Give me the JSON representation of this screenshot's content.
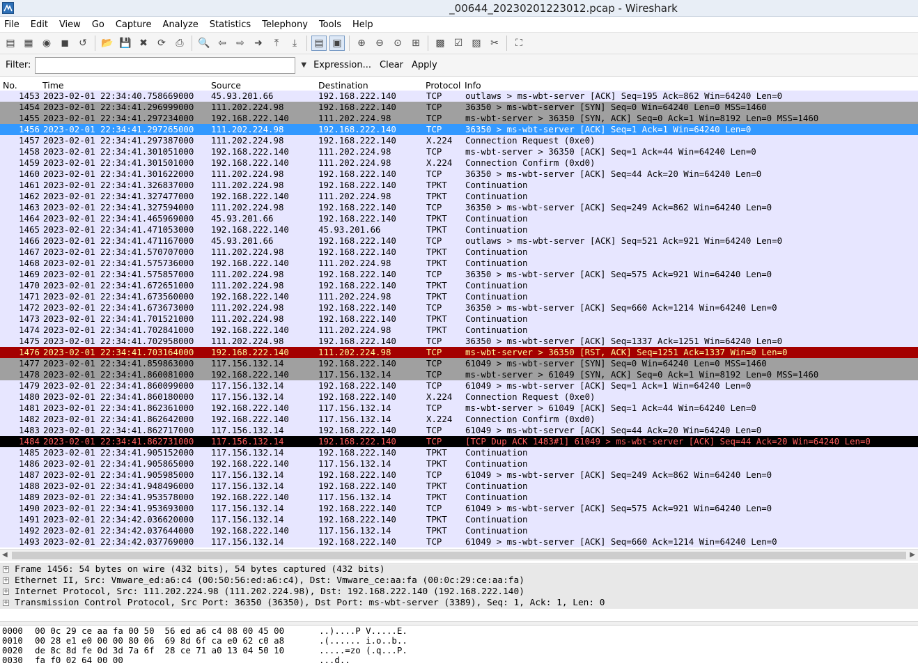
{
  "window": {
    "title": "_00644_20230201223012.pcap - Wireshark"
  },
  "menu": [
    "File",
    "Edit",
    "View",
    "Go",
    "Capture",
    "Analyze",
    "Statistics",
    "Telephony",
    "Tools",
    "Help"
  ],
  "toolbar": [
    {
      "name": "interfaces-icon",
      "glyph": "▤"
    },
    {
      "name": "capture-options-icon",
      "glyph": "▦"
    },
    {
      "name": "start-capture-icon",
      "glyph": "◉"
    },
    {
      "name": "stop-capture-icon",
      "glyph": "◼"
    },
    {
      "name": "restart-capture-icon",
      "glyph": "↺"
    },
    {
      "sep": true
    },
    {
      "name": "open-file-icon",
      "glyph": "📂"
    },
    {
      "name": "save-file-icon",
      "glyph": "💾"
    },
    {
      "name": "close-file-icon",
      "glyph": "✖"
    },
    {
      "name": "reload-icon",
      "glyph": "⟳"
    },
    {
      "name": "print-icon",
      "glyph": "⎙"
    },
    {
      "sep": true
    },
    {
      "name": "find-packet-icon",
      "glyph": "🔍"
    },
    {
      "name": "go-back-icon",
      "glyph": "⇦"
    },
    {
      "name": "go-forward-icon",
      "glyph": "⇨"
    },
    {
      "name": "go-to-packet-icon",
      "glyph": "➜"
    },
    {
      "name": "go-first-icon",
      "glyph": "⤒"
    },
    {
      "name": "go-last-icon",
      "glyph": "⤓"
    },
    {
      "sep": true
    },
    {
      "name": "colorize-icon",
      "glyph": "▤",
      "pressed": true
    },
    {
      "name": "auto-scroll-icon",
      "glyph": "▣",
      "pressed": true
    },
    {
      "sep": true
    },
    {
      "name": "zoom-in-icon",
      "glyph": "⊕"
    },
    {
      "name": "zoom-out-icon",
      "glyph": "⊖"
    },
    {
      "name": "zoom-normal-icon",
      "glyph": "⊙"
    },
    {
      "name": "resize-columns-icon",
      "glyph": "⊞"
    },
    {
      "sep": true
    },
    {
      "name": "capture-filters-icon",
      "glyph": "▩"
    },
    {
      "name": "display-filters-icon",
      "glyph": "☑"
    },
    {
      "name": "coloring-rules-icon",
      "glyph": "▨"
    },
    {
      "name": "preferences-icon",
      "glyph": "✂"
    },
    {
      "sep": true
    },
    {
      "name": "help-icon",
      "glyph": "⛶"
    }
  ],
  "filter": {
    "label": "Filter:",
    "value": "",
    "expression": "Expression...",
    "clear": "Clear",
    "apply": "Apply"
  },
  "columns": {
    "no": "No.",
    "time": "Time",
    "source": "Source",
    "destination": "Destination",
    "protocol": "Protocol",
    "info": "Info"
  },
  "colors": {
    "tcp": "#e7e6ff",
    "syn": "#a0a0a0",
    "selected": "#3399ff",
    "rst": "#a40000",
    "rst_fg": "#fffc9c",
    "dup_ack": "#000000",
    "dup_ack_fg": "#ff5f5f"
  },
  "packets": [
    {
      "no": "1453",
      "time": "2023-02-01 22:34:40.758669000",
      "src": "45.93.201.66",
      "dst": "192.168.222.140",
      "proto": "TCP",
      "info": "outlaws > ms-wbt-server [ACK] Seq=195 Ack=862 Win=64240 Len=0",
      "style": "tcp"
    },
    {
      "no": "1454",
      "time": "2023-02-01 22:34:41.296999000",
      "src": "111.202.224.98",
      "dst": "192.168.222.140",
      "proto": "TCP",
      "info": "36350 > ms-wbt-server [SYN] Seq=0 Win=64240 Len=0 MSS=1460",
      "style": "syn"
    },
    {
      "no": "1455",
      "time": "2023-02-01 22:34:41.297234000",
      "src": "192.168.222.140",
      "dst": "111.202.224.98",
      "proto": "TCP",
      "info": "ms-wbt-server > 36350 [SYN, ACK] Seq=0 Ack=1 Win=8192 Len=0 MSS=1460",
      "style": "syn"
    },
    {
      "no": "1456",
      "time": "2023-02-01 22:34:41.297265000",
      "src": "111.202.224.98",
      "dst": "192.168.222.140",
      "proto": "TCP",
      "info": "36350 > ms-wbt-server [ACK] Seq=1 Ack=1 Win=64240 Len=0",
      "style": "selected"
    },
    {
      "no": "1457",
      "time": "2023-02-01 22:34:41.297387000",
      "src": "111.202.224.98",
      "dst": "192.168.222.140",
      "proto": "X.224",
      "info": "Connection Request (0xe0)",
      "style": "tcp"
    },
    {
      "no": "1458",
      "time": "2023-02-01 22:34:41.301051000",
      "src": "192.168.222.140",
      "dst": "111.202.224.98",
      "proto": "TCP",
      "info": "ms-wbt-server > 36350 [ACK] Seq=1 Ack=44 Win=64240 Len=0",
      "style": "tcp"
    },
    {
      "no": "1459",
      "time": "2023-02-01 22:34:41.301501000",
      "src": "192.168.222.140",
      "dst": "111.202.224.98",
      "proto": "X.224",
      "info": "Connection Confirm (0xd0)",
      "style": "tcp"
    },
    {
      "no": "1460",
      "time": "2023-02-01 22:34:41.301622000",
      "src": "111.202.224.98",
      "dst": "192.168.222.140",
      "proto": "TCP",
      "info": "36350 > ms-wbt-server [ACK] Seq=44 Ack=20 Win=64240 Len=0",
      "style": "tcp"
    },
    {
      "no": "1461",
      "time": "2023-02-01 22:34:41.326837000",
      "src": "111.202.224.98",
      "dst": "192.168.222.140",
      "proto": "TPKT",
      "info": "Continuation",
      "style": "tcp"
    },
    {
      "no": "1462",
      "time": "2023-02-01 22:34:41.327477000",
      "src": "192.168.222.140",
      "dst": "111.202.224.98",
      "proto": "TPKT",
      "info": "Continuation",
      "style": "tcp"
    },
    {
      "no": "1463",
      "time": "2023-02-01 22:34:41.327594000",
      "src": "111.202.224.98",
      "dst": "192.168.222.140",
      "proto": "TCP",
      "info": "36350 > ms-wbt-server [ACK] Seq=249 Ack=862 Win=64240 Len=0",
      "style": "tcp"
    },
    {
      "no": "1464",
      "time": "2023-02-01 22:34:41.465969000",
      "src": "45.93.201.66",
      "dst": "192.168.222.140",
      "proto": "TPKT",
      "info": "Continuation",
      "style": "tcp"
    },
    {
      "no": "1465",
      "time": "2023-02-01 22:34:41.471053000",
      "src": "192.168.222.140",
      "dst": "45.93.201.66",
      "proto": "TPKT",
      "info": "Continuation",
      "style": "tcp"
    },
    {
      "no": "1466",
      "time": "2023-02-01 22:34:41.471167000",
      "src": "45.93.201.66",
      "dst": "192.168.222.140",
      "proto": "TCP",
      "info": "outlaws > ms-wbt-server [ACK] Seq=521 Ack=921 Win=64240 Len=0",
      "style": "tcp"
    },
    {
      "no": "1467",
      "time": "2023-02-01 22:34:41.570707000",
      "src": "111.202.224.98",
      "dst": "192.168.222.140",
      "proto": "TPKT",
      "info": "Continuation",
      "style": "tcp"
    },
    {
      "no": "1468",
      "time": "2023-02-01 22:34:41.575736000",
      "src": "192.168.222.140",
      "dst": "111.202.224.98",
      "proto": "TPKT",
      "info": "Continuation",
      "style": "tcp"
    },
    {
      "no": "1469",
      "time": "2023-02-01 22:34:41.575857000",
      "src": "111.202.224.98",
      "dst": "192.168.222.140",
      "proto": "TCP",
      "info": "36350 > ms-wbt-server [ACK] Seq=575 Ack=921 Win=64240 Len=0",
      "style": "tcp"
    },
    {
      "no": "1470",
      "time": "2023-02-01 22:34:41.672651000",
      "src": "111.202.224.98",
      "dst": "192.168.222.140",
      "proto": "TPKT",
      "info": "Continuation",
      "style": "tcp"
    },
    {
      "no": "1471",
      "time": "2023-02-01 22:34:41.673560000",
      "src": "192.168.222.140",
      "dst": "111.202.224.98",
      "proto": "TPKT",
      "info": "Continuation",
      "style": "tcp"
    },
    {
      "no": "1472",
      "time": "2023-02-01 22:34:41.673673000",
      "src": "111.202.224.98",
      "dst": "192.168.222.140",
      "proto": "TCP",
      "info": "36350 > ms-wbt-server [ACK] Seq=660 Ack=1214 Win=64240 Len=0",
      "style": "tcp"
    },
    {
      "no": "1473",
      "time": "2023-02-01 22:34:41.701521000",
      "src": "111.202.224.98",
      "dst": "192.168.222.140",
      "proto": "TPKT",
      "info": "Continuation",
      "style": "tcp"
    },
    {
      "no": "1474",
      "time": "2023-02-01 22:34:41.702841000",
      "src": "192.168.222.140",
      "dst": "111.202.224.98",
      "proto": "TPKT",
      "info": "Continuation",
      "style": "tcp"
    },
    {
      "no": "1475",
      "time": "2023-02-01 22:34:41.702958000",
      "src": "111.202.224.98",
      "dst": "192.168.222.140",
      "proto": "TCP",
      "info": "36350 > ms-wbt-server [ACK] Seq=1337 Ack=1251 Win=64240 Len=0",
      "style": "tcp"
    },
    {
      "no": "1476",
      "time": "2023-02-01 22:34:41.703164000",
      "src": "192.168.222.140",
      "dst": "111.202.224.98",
      "proto": "TCP",
      "info": "ms-wbt-server > 36350 [RST, ACK] Seq=1251 Ack=1337 Win=0 Len=0",
      "style": "rst"
    },
    {
      "no": "1477",
      "time": "2023-02-01 22:34:41.859863000",
      "src": "117.156.132.14",
      "dst": "192.168.222.140",
      "proto": "TCP",
      "info": "61049 > ms-wbt-server [SYN] Seq=0 Win=64240 Len=0 MSS=1460",
      "style": "syn"
    },
    {
      "no": "1478",
      "time": "2023-02-01 22:34:41.860081000",
      "src": "192.168.222.140",
      "dst": "117.156.132.14",
      "proto": "TCP",
      "info": "ms-wbt-server > 61049 [SYN, ACK] Seq=0 Ack=1 Win=8192 Len=0 MSS=1460",
      "style": "syn"
    },
    {
      "no": "1479",
      "time": "2023-02-01 22:34:41.860099000",
      "src": "117.156.132.14",
      "dst": "192.168.222.140",
      "proto": "TCP",
      "info": "61049 > ms-wbt-server [ACK] Seq=1 Ack=1 Win=64240 Len=0",
      "style": "tcp"
    },
    {
      "no": "1480",
      "time": "2023-02-01 22:34:41.860180000",
      "src": "117.156.132.14",
      "dst": "192.168.222.140",
      "proto": "X.224",
      "info": "Connection Request (0xe0)",
      "style": "tcp"
    },
    {
      "no": "1481",
      "time": "2023-02-01 22:34:41.862361000",
      "src": "192.168.222.140",
      "dst": "117.156.132.14",
      "proto": "TCP",
      "info": "ms-wbt-server > 61049 [ACK] Seq=1 Ack=44 Win=64240 Len=0",
      "style": "tcp"
    },
    {
      "no": "1482",
      "time": "2023-02-01 22:34:41.862642000",
      "src": "192.168.222.140",
      "dst": "117.156.132.14",
      "proto": "X.224",
      "info": "Connection Confirm (0xd0)",
      "style": "tcp"
    },
    {
      "no": "1483",
      "time": "2023-02-01 22:34:41.862717000",
      "src": "117.156.132.14",
      "dst": "192.168.222.140",
      "proto": "TCP",
      "info": "61049 > ms-wbt-server [ACK] Seq=44 Ack=20 Win=64240 Len=0",
      "style": "tcp"
    },
    {
      "no": "1484",
      "time": "2023-02-01 22:34:41.862731000",
      "src": "117.156.132.14",
      "dst": "192.168.222.140",
      "proto": "TCP",
      "info": "[TCP Dup ACK 1483#1] 61049 > ms-wbt-server [ACK] Seq=44 Ack=20 Win=64240 Len=0",
      "style": "dupack"
    },
    {
      "no": "1485",
      "time": "2023-02-01 22:34:41.905152000",
      "src": "117.156.132.14",
      "dst": "192.168.222.140",
      "proto": "TPKT",
      "info": "Continuation",
      "style": "tcp"
    },
    {
      "no": "1486",
      "time": "2023-02-01 22:34:41.905865000",
      "src": "192.168.222.140",
      "dst": "117.156.132.14",
      "proto": "TPKT",
      "info": "Continuation",
      "style": "tcp"
    },
    {
      "no": "1487",
      "time": "2023-02-01 22:34:41.905985000",
      "src": "117.156.132.14",
      "dst": "192.168.222.140",
      "proto": "TCP",
      "info": "61049 > ms-wbt-server [ACK] Seq=249 Ack=862 Win=64240 Len=0",
      "style": "tcp"
    },
    {
      "no": "1488",
      "time": "2023-02-01 22:34:41.948496000",
      "src": "117.156.132.14",
      "dst": "192.168.222.140",
      "proto": "TPKT",
      "info": "Continuation",
      "style": "tcp"
    },
    {
      "no": "1489",
      "time": "2023-02-01 22:34:41.953578000",
      "src": "192.168.222.140",
      "dst": "117.156.132.14",
      "proto": "TPKT",
      "info": "Continuation",
      "style": "tcp"
    },
    {
      "no": "1490",
      "time": "2023-02-01 22:34:41.953693000",
      "src": "117.156.132.14",
      "dst": "192.168.222.140",
      "proto": "TCP",
      "info": "61049 > ms-wbt-server [ACK] Seq=575 Ack=921 Win=64240 Len=0",
      "style": "tcp"
    },
    {
      "no": "1491",
      "time": "2023-02-01 22:34:42.036620000",
      "src": "117.156.132.14",
      "dst": "192.168.222.140",
      "proto": "TPKT",
      "info": "Continuation",
      "style": "tcp"
    },
    {
      "no": "1492",
      "time": "2023-02-01 22:34:42.037644000",
      "src": "192.168.222.140",
      "dst": "117.156.132.14",
      "proto": "TPKT",
      "info": "Continuation",
      "style": "tcp"
    },
    {
      "no": "1493",
      "time": "2023-02-01 22:34:42.037769000",
      "src": "117.156.132.14",
      "dst": "192.168.222.140",
      "proto": "TCP",
      "info": "61049 > ms-wbt-server [ACK] Seq=660 Ack=1214 Win=64240 Len=0",
      "style": "tcp"
    }
  ],
  "details": [
    "Frame 1456: 54 bytes on wire (432 bits), 54 bytes captured (432 bits)",
    "Ethernet II, Src: Vmware_ed:a6:c4 (00:50:56:ed:a6:c4), Dst: Vmware_ce:aa:fa (00:0c:29:ce:aa:fa)",
    "Internet Protocol, Src: 111.202.224.98 (111.202.224.98), Dst: 192.168.222.140 (192.168.222.140)",
    "Transmission Control Protocol, Src Port: 36350 (36350), Dst Port: ms-wbt-server (3389), Seq: 1, Ack: 1, Len: 0"
  ],
  "details_expander": "+",
  "bytes": [
    {
      "offset": "0000",
      "hex": "00 0c 29 ce aa fa 00 50  56 ed a6 c4 08 00 45 00",
      "ascii": "..)....P V.....E."
    },
    {
      "offset": "0010",
      "hex": "00 28 e1 e0 00 00 80 06  69 8d 6f ca e0 62 c0 a8",
      "ascii": ".(...... i.o..b.."
    },
    {
      "offset": "0020",
      "hex": "de 8c 8d fe 0d 3d 7a 6f  28 ce 71 a0 13 04 50 10",
      "ascii": ".....=zo (.q...P."
    },
    {
      "offset": "0030",
      "hex": "fa f0 02 64 00 00",
      "ascii": "...d.."
    }
  ]
}
